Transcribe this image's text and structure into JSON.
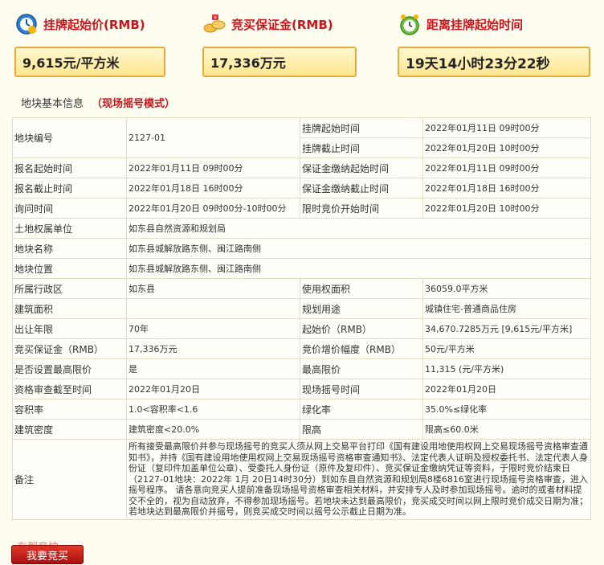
{
  "metrics": {
    "start_price_label": "挂牌起始价(RMB)",
    "start_price_value": "9,615元/平方米",
    "deposit_label": "竞买保证金(RMB)",
    "deposit_value": "17,336万元",
    "countdown_label": "距离挂牌起始时间",
    "countdown_value": "19天14小时23分22秒"
  },
  "section": {
    "title": "地块基本信息",
    "mode": "（现场摇号模式）"
  },
  "table": {
    "r1": {
      "k1": "地块编号",
      "v1": "2127-01",
      "k2a": "挂牌起始时间",
      "v2a": "2022年01月11日 09时00分",
      "k2b": "挂牌截止时间",
      "v2b": "2022年01月20日 10时00分"
    },
    "r2": {
      "k1": "报名起始时间",
      "v1": "2022年01月11日 09时00分",
      "k2": "保证金缴纳起始时间",
      "v2": "2022年01月11日 09时00分"
    },
    "r3": {
      "k1": "报名截止时间",
      "v1": "2022年01月18日 16时00分",
      "k2": "保证金缴纳截止时间",
      "v2": "2022年01月18日 16时00分"
    },
    "r4": {
      "k1": "询问时间",
      "v1": "2022年01月20日 09时00分-10时00分",
      "k2": "限时竞价开始时间",
      "v2": "2022年01月20日 10时00分"
    },
    "r5": {
      "k1": "土地权属单位",
      "v1": "如东县自然资源和规划局"
    },
    "r6": {
      "k1": "地块名称",
      "v1": "如东县城解放路东侧、闽江路南侧"
    },
    "r7": {
      "k1": "地块位置",
      "v1": "如东县城解放路东侧、闽江路南侧"
    },
    "r8": {
      "k1": "所属行政区",
      "v1": "如东县",
      "k2": "使用权面积",
      "v2": "36059.0平方米"
    },
    "r9": {
      "k1": "建筑面积",
      "v1": "",
      "k2": "规划用途",
      "v2": "城镇住宅-普通商品住房"
    },
    "r10": {
      "k1": "出让年限",
      "v1": "70年",
      "k2": "起始价（RMB）",
      "v2": "34,670.7285万元 [9,615元/平方米]"
    },
    "r11": {
      "k1": "竞买保证金（RMB）",
      "v1": "17,336万元",
      "k2": "竞价增价幅度（RMB）",
      "v2": "50元/平方米"
    },
    "r12": {
      "k1": "是否设置最高限价",
      "v1": "是",
      "k2": "最高限价",
      "v2": "11,315 (元/平方米)"
    },
    "r13": {
      "k1": "资格审查截至时间",
      "v1": "2022年01月20日",
      "k2": "现场摇号时间",
      "v2": "2022年01月20日"
    },
    "r14": {
      "k1": "容积率",
      "v1": "1.0<容积率<1.6",
      "k2": "绿化率",
      "v2": "35.0%≤绿化率"
    },
    "r15": {
      "k1": "建筑密度",
      "v1": "建筑密度<20.0%",
      "k2": "限高",
      "v2": "限高≤60.0米"
    },
    "r16": {
      "k1": "备注",
      "v1": "所有接受最高限价并参与现场摇号的竞买人须从网上交易平台打印《国有建设用地使用权网上交易现场摇号资格审查通知书》，并持《国有建设用地使用权网上交易现场摇号资格审查通知书》、法定代表人证明及授权委托书、法定代表人身份证（复印件加盖单位公章）、受委托人身份证（原件及复印件）、竞买保证金缴纳凭证等资料，于限时竞价结束日（2127-01地块：2022年 1月 20日14时30分）到如东县自然资源和规划局8楼6816室进行现场摇号资格审查，进入摇号程序。 请各意向竞买人提前准备现场摇号资格审查相关材料，并安排专人及时参加现场摇号。逾时的或者材料提交不全的，视为自动放弃，不得参加现场摇号。若地块未达到最高限价，竞买成交时间以网上限时竞价成交日期为准；若地块达到最高限价并摇号，则竞买成交时间以摇号公示截止日期为准。"
    }
  },
  "bid_button": {
    "label": "我要竞买",
    "ghost_text": "东郡竞拍"
  },
  "colors": {
    "accent_red": "#c8161d",
    "box_border": "#e3ad3b",
    "background": "#fffdf0"
  }
}
